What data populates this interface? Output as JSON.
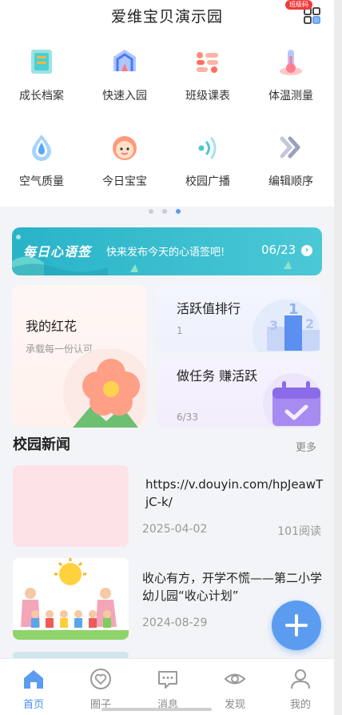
{
  "header": {
    "title": "爱维宝贝演示园",
    "class_code_badge": "班级码",
    "class_code_icon": "grid-icon"
  },
  "grid": [
    {
      "label": "成长档案",
      "icon": "growth-file-icon"
    },
    {
      "label": "快速入园",
      "icon": "quick-entry-icon"
    },
    {
      "label": "班级课表",
      "icon": "class-schedule-icon"
    },
    {
      "label": "体温测量",
      "icon": "thermometer-icon"
    },
    {
      "label": "空气质量",
      "icon": "air-quality-icon"
    },
    {
      "label": "今日宝宝",
      "icon": "today-baby-icon"
    },
    {
      "label": "校园广播",
      "icon": "broadcast-icon"
    },
    {
      "label": "编辑顺序",
      "icon": "edit-order-icon"
    }
  ],
  "pager": {
    "count": 3,
    "active_index": 2
  },
  "banner": {
    "title": "每日心语签",
    "text": "快来发布今天的心语签吧!",
    "date": "06/23"
  },
  "cards": {
    "flower": {
      "title": "我的红花",
      "subtitle": "承载每一份认可"
    },
    "rank": {
      "title": "活跃值排行",
      "value": "1"
    },
    "task": {
      "title": "做任务 赚活跃",
      "progress": "6/33"
    }
  },
  "news": {
    "heading": "校园新闻",
    "more": "更多",
    "items": [
      {
        "title": "https://v.douyin.com/hpJeawTjC-k/",
        "date": "2025-04-02",
        "reads": "101阅读"
      },
      {
        "title": "收心有方，开学不慌——第二小学幼儿园“收心计划”",
        "date": "2024-08-29",
        "reads": ""
      }
    ]
  },
  "tabbar": [
    {
      "label": "首页",
      "icon": "home-icon",
      "active": true
    },
    {
      "label": "圈子",
      "icon": "heart-circle-icon",
      "active": false
    },
    {
      "label": "消息",
      "icon": "message-icon",
      "active": false
    },
    {
      "label": "发现",
      "icon": "eye-icon",
      "active": false
    },
    {
      "label": "我的",
      "icon": "user-icon",
      "active": false
    }
  ],
  "colors": {
    "accent": "#4a8ef0",
    "banner": "#2bb3c8",
    "fab": "#5b9cf0",
    "badge": "#ef3b3b"
  }
}
